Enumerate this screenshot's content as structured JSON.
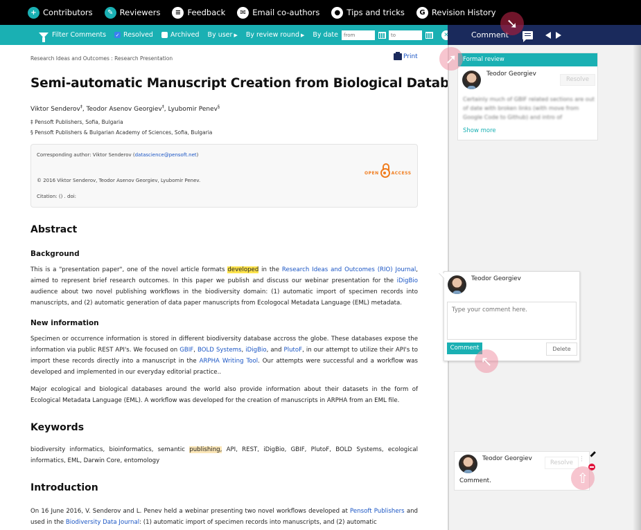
{
  "topnav": {
    "items": [
      {
        "label": "Contributors",
        "icon": "add-user-icon"
      },
      {
        "label": "Reviewers",
        "icon": "reviewer-pen-icon"
      },
      {
        "label": "Feedback",
        "icon": "feedback-icon"
      },
      {
        "label": "Email co-authors",
        "icon": "envelope-icon"
      },
      {
        "label": "Tips and tricks",
        "icon": "lightbulb-icon"
      },
      {
        "label": "Revision History",
        "icon": "history-icon"
      }
    ]
  },
  "filterbar": {
    "title": "Filter Comments",
    "resolved_label": "Resolved",
    "resolved_checked": true,
    "archived_label": "Archived",
    "archived_checked": false,
    "by_user": "By user",
    "by_review_round": "By review round",
    "by_date": "By date",
    "from_placeholder": "from",
    "to_placeholder": "to"
  },
  "panel_header": {
    "label": "Comment"
  },
  "article": {
    "breadcrumb": "Research Ideas and Outcomes : Research Presentation",
    "print_label": "Print",
    "title": "Semi-automatic Manuscript Creation from Biological Databases",
    "authors": [
      {
        "name": "Viktor Senderov",
        "mark": "‡"
      },
      {
        "name": "Teodor Asenov Georgiev",
        "mark": "‡"
      },
      {
        "name": "Lyubomir Penev",
        "mark": "§"
      }
    ],
    "affiliations": [
      "‡ Pensoft Publishers, Sofia, Bulgaria",
      "§ Pensoft Publishers & Bulgarian Academy of Sciences, Sofia, Bulgaria"
    ],
    "infobox": {
      "corresponding_prefix": "Corresponding author: Viktor Senderov (",
      "corresponding_email": "datascience@pensoft.net",
      "corresponding_suffix": ")",
      "copyright": "© 2016 Viktor Senderov, Teodor Asenov Georgiev, Lyubomir Penev.",
      "citation": "Citation: () . doi:",
      "oa_left": "OPEN",
      "oa_right": "ACCESS"
    },
    "abstract_heading": "Abstract",
    "background_heading": "Background",
    "background": {
      "t1": "This is a \"presentation paper\",  one of the novel article formats ",
      "highlight": "developed",
      "t2": " in the ",
      "link1": "Research Ideas and Outcomes (RIO) Journal",
      "t3": ", aimed to represent brief research outcomes. In this paper we publish and discuss our webinar presentation for the ",
      "link2": "iDigBio",
      "t4": " audience about two novel publishing workflows in the biodiversity domain: (1) automatic import of specimen records into manuscripts, and (2) automatic generation of data paper manuscripts from Ecologocal Metadata Language (EML) metadata."
    },
    "newinfo_heading": "New information",
    "newinfo": {
      "t1": "Specimen or occurrence information is stored in different biodiversity database accross the globe. These databases expose the information via public REST API's. We focused on ",
      "l1": "GBIF",
      "s1": ", ",
      "l2": "BOLD Systems",
      "s2": ", ",
      "l3": "iDigBio",
      "s3": ", and ",
      "l4": "PlutoF",
      "t2": ", in our attempt to utilize their API's to import these records directly into a manuscript in the ",
      "l5": "ARPHA Writing Tool",
      "t3": ". Our attempts were successful and a workflow was developed and implemented in our everyday editorial practice.."
    },
    "newinfo2": "Major ecological and biological databases around the world also provide information about their datasets in the form of Ecological Metadata Language (EML). A workflow was developed for the creation of manuscripts in ARPHA from an EML file.",
    "keywords_heading": "Keywords",
    "keywords": {
      "t1": "biodiversity informatics, bioinformatics, semantic ",
      "highlight": "publishing,",
      "t2": " API, REST, iDigBio, GBIF, PlutoF, BOLD Systems, ecological informatics, EML, Darwin Core, entomology"
    },
    "intro_heading": "Introduction",
    "intro": {
      "t1": "On 16 June 2016, V. Senderov and L. Penev held a webinar presenting two novel workflows developed at ",
      "l1": "Pensoft Publishers",
      "t2": " and used in the ",
      "l2": "Biodiversity Data Journal",
      "t3": ": (1) automatic import of specimen records into manuscripts, and (2) automatic"
    }
  },
  "sidebar": {
    "formal_review": {
      "header": "Formal review",
      "user": "Teodor Georgiev",
      "resolve_label": "Resolve",
      "text": "Certainly much of GBIF related sections are out of date with broken links (with move from Google Code to Github) and intro of",
      "show_more": "Show more"
    },
    "new_comment": {
      "user": "Teodor Georgiev",
      "placeholder": "Type your comment here.",
      "comment_button": "Comment",
      "delete_button": "Delete"
    },
    "posted_comment": {
      "user": "Teodor Georgiev",
      "resolve_label": "Resolve",
      "text": "Comment."
    }
  },
  "colors": {
    "teal": "#1ab0b3",
    "navy": "#1a2a5c",
    "link": "#1a55c4",
    "open_access": "#f07c1d",
    "highlight_yellow": "#ffe44d",
    "highlight_beige": "#fbe6b7"
  }
}
